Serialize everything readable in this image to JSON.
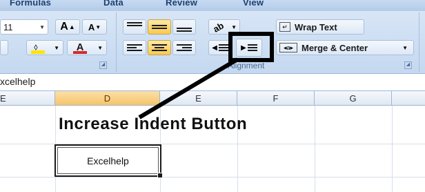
{
  "ribbon": {
    "tabs": [
      "Formulas",
      "Data",
      "Review",
      "View"
    ],
    "font_size": "11",
    "grow_font_glyph": "A",
    "shrink_font_glyph": "A",
    "font_color_glyph": "A",
    "wrap_text_label": "Wrap Text",
    "merge_center_label": "Merge & Center",
    "alignment_group_label": "Alignment",
    "accent": "#f9c94f",
    "font_color": "#d8262b",
    "fill_color": "#ffe400"
  },
  "formula_bar": {
    "value": "xcelhelp"
  },
  "columns": [
    "E",
    "D",
    "E",
    "F",
    "G"
  ],
  "sheet": {
    "heading": "Increase Indent Button",
    "cell_text": "Excelhelp"
  },
  "annotation": {
    "target": "increase-indent-button"
  }
}
